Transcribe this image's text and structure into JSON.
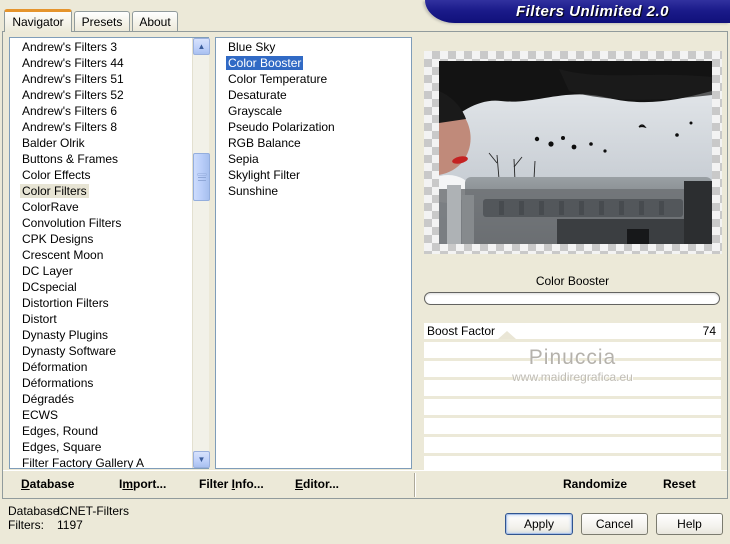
{
  "window": {
    "title": "Filters Unlimited 2.0"
  },
  "tabs": [
    {
      "label": "Navigator",
      "active": true
    },
    {
      "label": "Presets",
      "active": false
    },
    {
      "label": "About",
      "active": false
    }
  ],
  "category_list": {
    "selected": "Color Filters",
    "items": [
      "Andrew's Filters 3",
      "Andrew's Filters 44",
      "Andrew's Filters 51",
      "Andrew's Filters 52",
      "Andrew's Filters 6",
      "Andrew's Filters 8",
      "Balder Olrik",
      "Buttons & Frames",
      "Color Effects",
      "Color Filters",
      "ColorRave",
      "Convolution Filters",
      "CPK Designs",
      "Crescent Moon",
      "DC Layer",
      "DCspecial",
      "Distortion Filters",
      "Distort",
      "Dynasty Plugins",
      "Dynasty Software",
      "Déformation",
      "Déformations",
      "Dégradés",
      "ECWS",
      "Edges, Round",
      "Edges, Square",
      "Filter Factory Gallery A"
    ]
  },
  "filter_list": {
    "selected": "Color Booster",
    "items": [
      "Blue Sky",
      "Color Booster",
      "Color Temperature",
      "Desaturate",
      "Grayscale",
      "Pseudo Polarization",
      "RGB Balance",
      "Sepia",
      "Skylight Filter",
      "Sunshine"
    ]
  },
  "filter_panel": {
    "filter_name": "Color Booster",
    "params": [
      {
        "name": "Boost Factor",
        "value": "74",
        "marker_percent": 28
      }
    ],
    "empty_rows": 7
  },
  "preview_watermark": {
    "title": "Pinuccia",
    "url": "www.maidiregrafica.eu"
  },
  "toolbar_buttons": [
    {
      "pre": "",
      "key": "D",
      "post": "atabase"
    },
    {
      "pre": "I",
      "key": "m",
      "post": "port..."
    },
    {
      "pre": "Filter ",
      "key": "I",
      "post": "nfo..."
    },
    {
      "pre": "",
      "key": "E",
      "post": "ditor..."
    },
    {
      "pre": "Randomize",
      "key": "",
      "post": ""
    },
    {
      "pre": "Reset",
      "key": "",
      "post": ""
    }
  ],
  "status": {
    "database_label": "Database:",
    "database_value": "ICNET-Filters",
    "filters_label": "Filters:",
    "filters_value": "1197"
  },
  "dialog_buttons": {
    "apply": "Apply",
    "cancel": "Cancel",
    "help": "Help"
  },
  "colors": {
    "dialog_bg": "#ece9d8",
    "banner": "#15157f",
    "selection_active": "#316ac5",
    "selection_inactive": "#e7e4d4",
    "tab_accent_orange": "#e5942c"
  }
}
